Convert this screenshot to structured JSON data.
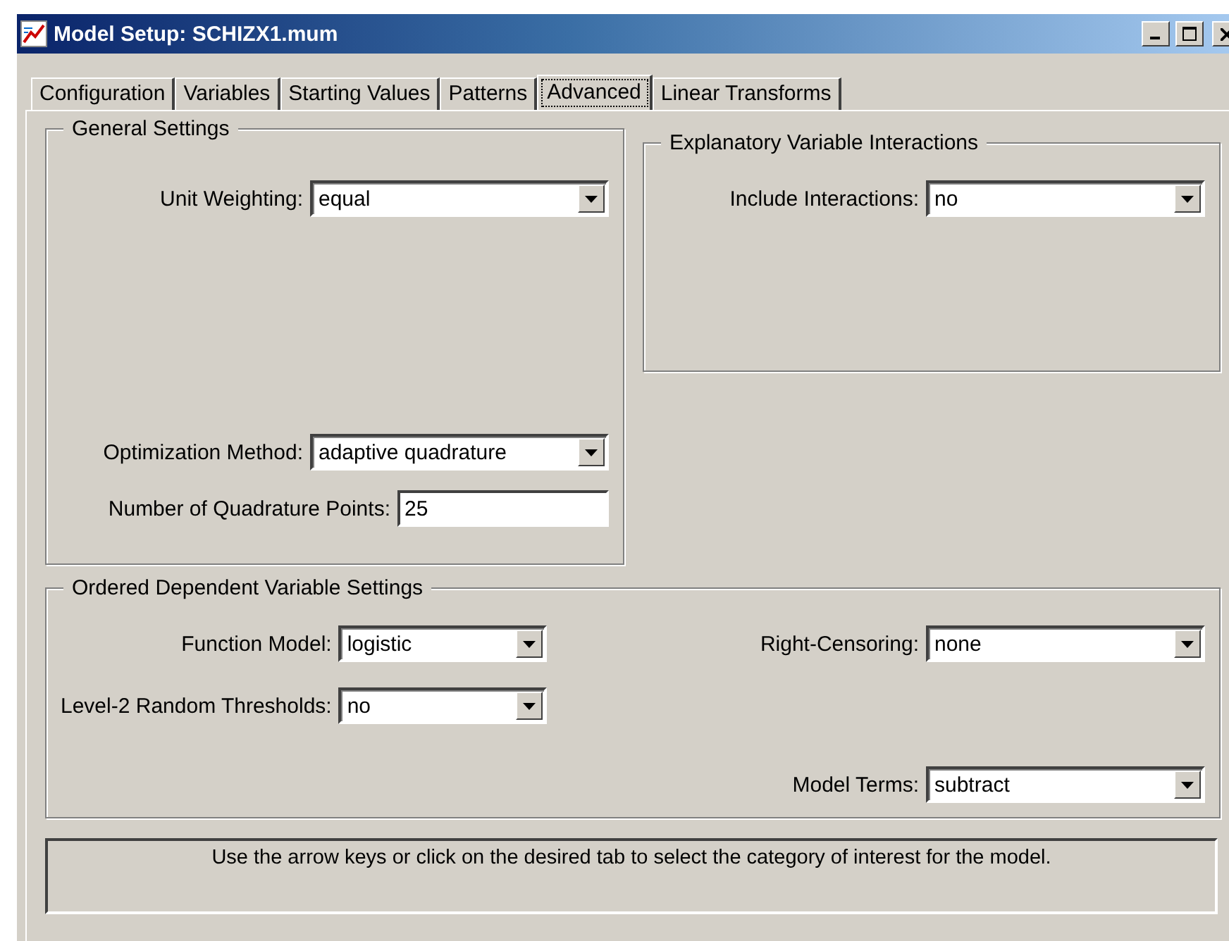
{
  "window": {
    "title": "Model Setup: SCHIZX1.mum"
  },
  "tabs": [
    {
      "label": "Configuration",
      "selected": false
    },
    {
      "label": "Variables",
      "selected": false
    },
    {
      "label": "Starting Values",
      "selected": false
    },
    {
      "label": "Patterns",
      "selected": false
    },
    {
      "label": "Advanced",
      "selected": true
    },
    {
      "label": "Linear Transforms",
      "selected": false
    }
  ],
  "general_settings": {
    "title": "General Settings",
    "fields": [
      {
        "kind": "dropdown",
        "label": "Unit Weighting:",
        "value": "equal"
      },
      {
        "kind": "dropdown",
        "label": "Optimization Method:",
        "value": "adaptive quadrature"
      },
      {
        "kind": "text",
        "label": "Number of Quadrature Points:",
        "value": "25"
      }
    ]
  },
  "explanatory_interactions": {
    "title": "Explanatory Variable Interactions",
    "fields": [
      {
        "kind": "dropdown",
        "label": "Include Interactions:",
        "value": "no"
      }
    ]
  },
  "ordered_settings": {
    "title": "Ordered Dependent Variable Settings",
    "left_fields": [
      {
        "kind": "dropdown",
        "label": "Function Model:",
        "value": "logistic"
      },
      {
        "kind": "dropdown",
        "label": "Level-2 Random Thresholds:",
        "value": "no"
      }
    ],
    "right_fields": [
      {
        "kind": "dropdown",
        "label": "Right-Censoring:",
        "value": "none"
      },
      {
        "kind": "dropdown",
        "label": "Model Terms:",
        "value": "subtract"
      }
    ]
  },
  "hint": "Use the arrow keys or click on the desired tab to select the category of interest for the model."
}
